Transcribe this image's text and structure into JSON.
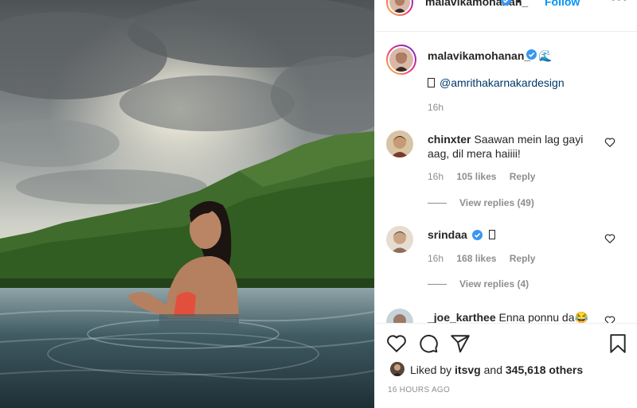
{
  "post": {
    "username": "malavikamohanan_",
    "follow_label": "Follow",
    "separator": "•",
    "more_label": "•••",
    "caption_emoji": "🌊",
    "caption_mention": "@amrithakarnakardesign",
    "caption_time": "16h",
    "posted_time": "16 HOURS AGO"
  },
  "comments": [
    {
      "username": "chinxter",
      "text": "Saawan mein lag gayi aag, dil mera haiiii!",
      "time": "16h",
      "likes": "105 likes",
      "reply_label": "Reply",
      "view_replies": "View replies (49)"
    },
    {
      "username": "srindaa",
      "verified": true,
      "text": "",
      "time": "16h",
      "likes": "168 likes",
      "reply_label": "Reply",
      "view_replies": "View replies (4)"
    },
    {
      "username": "_joe_karthee",
      "text": "Enna ponnu da😂"
    }
  ],
  "likes": {
    "prefix": "Liked by",
    "user": "itsvg",
    "connector": "and",
    "count": "345,618 others"
  },
  "colors": {
    "accent": "#0095f6",
    "verified": "#3897f0",
    "muted": "#8e8e8e",
    "mention": "#00376b"
  },
  "icons": [
    "heart-icon",
    "comment-icon",
    "share-icon",
    "bookmark-icon",
    "verified-icon",
    "more-icon"
  ]
}
